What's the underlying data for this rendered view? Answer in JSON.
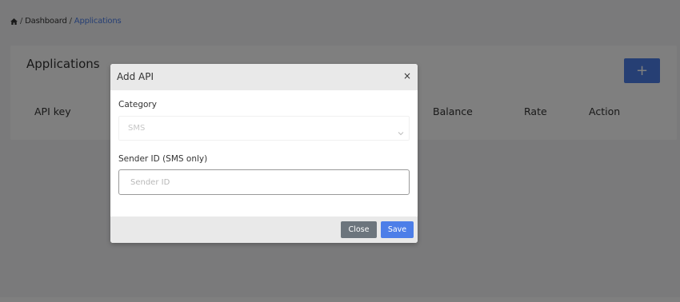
{
  "breadcrumb": {
    "home_icon": "home-icon",
    "separator": "/",
    "items": [
      "Dashboard",
      "Applications"
    ]
  },
  "page": {
    "title": "Applications",
    "add_button_label": "+",
    "table_headers": [
      "API key",
      "Balance",
      "Rate",
      "Action"
    ]
  },
  "modal": {
    "title": "Add API",
    "close_symbol": "×",
    "category": {
      "label": "Category",
      "selected": "SMS"
    },
    "sender": {
      "label": "Sender ID (SMS only)",
      "value": "",
      "placeholder": "Sender ID"
    },
    "buttons": {
      "close": "Close",
      "save": "Save"
    }
  },
  "colors": {
    "accent": "#4d7ee8",
    "secondary_button": "#6c757d",
    "backdrop": "rgba(0,0,0,0.5)"
  }
}
